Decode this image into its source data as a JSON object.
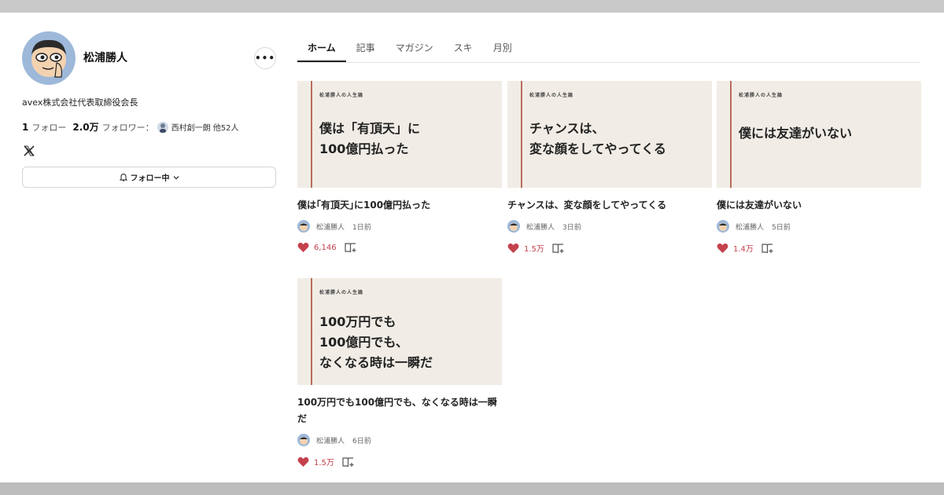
{
  "profile": {
    "name": "松浦勝人",
    "more_label": "•••",
    "bio": "avex株式会社代表取締役会長",
    "following_count": "1",
    "following_label": "フォロー",
    "followers_count": "2.0万",
    "followers_label": "フォロワー：",
    "followed_by": "西村創一朗 他52人",
    "follow_button_label": "フォロー中",
    "social_icon": "x-icon"
  },
  "tabs": [
    {
      "label": "ホーム",
      "active": true
    },
    {
      "label": "記事",
      "active": false
    },
    {
      "label": "マガジン",
      "active": false
    },
    {
      "label": "スキ",
      "active": false
    },
    {
      "label": "月別",
      "active": false
    }
  ],
  "articles": [
    {
      "series": "松浦勝人の人生論",
      "thumb_title": "僕は「有頂天」に\n100億円払った",
      "title": "僕は｢有頂天｣に100億円払った",
      "author": "松浦勝人",
      "date": "1日前",
      "likes": "6,146"
    },
    {
      "series": "松浦勝人の人生論",
      "thumb_title": "チャンスは、\n変な顔をしてやってくる",
      "title": "チャンスは、変な顔をしてやってくる",
      "author": "松浦勝人",
      "date": "3日前",
      "likes": "1.5万"
    },
    {
      "series": "松浦勝人の人生論",
      "thumb_title": "僕には友達がいない",
      "title": "僕には友達がいない",
      "author": "松浦勝人",
      "date": "5日前",
      "likes": "1.4万"
    },
    {
      "series": "松浦勝人の人生論",
      "thumb_title": "100万円でも\n100億円でも、\nなくなる時は一瞬だ",
      "title": "100万円でも100億円でも、なくなる時は一瞬だ",
      "author": "松浦勝人",
      "date": "6日前",
      "likes": "1.5万"
    }
  ],
  "colors": {
    "thumb_bg": "#f1ede6",
    "thumb_accent": "#b96d5b",
    "like": "#c4414d",
    "avatar_bg": "#9db8d9"
  }
}
